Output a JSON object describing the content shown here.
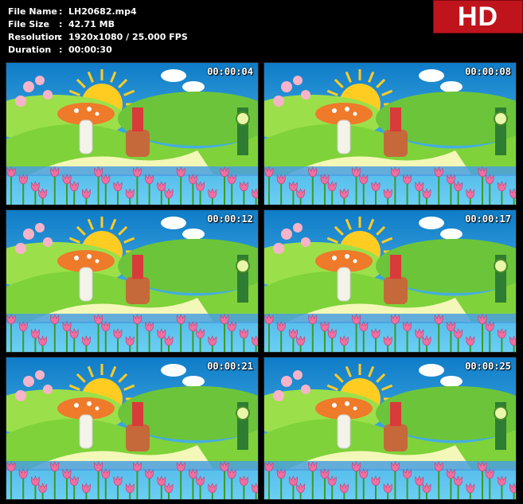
{
  "file_info": {
    "rows": [
      {
        "label": "File Name",
        "sep": ":",
        "value": "LH20682.mp4"
      },
      {
        "label": "File Size",
        "sep": ":",
        "value": "42.71 MB"
      },
      {
        "label": "Resolution",
        "sep": ":",
        "value": "1920x1080 / 25.000 FPS"
      },
      {
        "label": "Duration",
        "sep": ":",
        "value": "00:00:30"
      }
    ]
  },
  "badge": {
    "text": "HD",
    "color": "#c0141c"
  },
  "thumbnails": [
    {
      "timestamp": "00:00:04"
    },
    {
      "timestamp": "00:00:08"
    },
    {
      "timestamp": "00:00:12"
    },
    {
      "timestamp": "00:00:17"
    },
    {
      "timestamp": "00:00:21"
    },
    {
      "timestamp": "00:00:25"
    }
  ],
  "colors": {
    "sky": "#1e9ad8",
    "grass": "#7fd23a",
    "water": "#4aa0e0",
    "tulip": "#f06fa0",
    "sun": "#ffcc22"
  }
}
